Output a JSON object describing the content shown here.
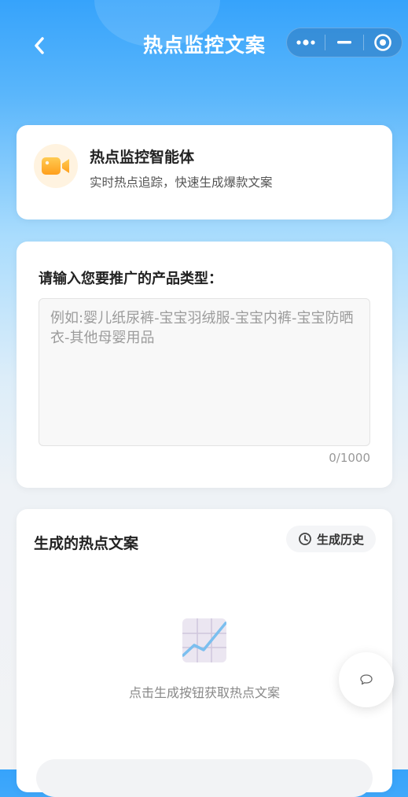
{
  "header": {
    "title": "热点监控文案",
    "back_icon": "chevron-left-icon",
    "capsule_icons": [
      "more-dots-icon",
      "minimize-icon",
      "close-target-icon"
    ]
  },
  "agent": {
    "name": "热点监控智能体",
    "description": "实时热点追踪，快速生成爆款文案",
    "icon": "video-camera-icon"
  },
  "input_section": {
    "label": "请输入您要推广的产品类型：",
    "value": "",
    "placeholder": "例如:婴儿纸尿裤-宝宝羽绒服-宝宝内裤-宝宝防晒衣-其他母婴用品",
    "counter": "0/1000"
  },
  "result_section": {
    "title": "生成的热点文案",
    "history_label": "生成历史",
    "history_icon": "clock-icon",
    "empty_icon": "trend-chart-icon",
    "empty_text": "点击生成按钮获取热点文案"
  },
  "floating": {
    "icon": "chat-bubble-icon"
  },
  "colors": {
    "primary": "#36a3fb",
    "accent_orange": "#ffb43a",
    "muted_text": "#888888"
  }
}
